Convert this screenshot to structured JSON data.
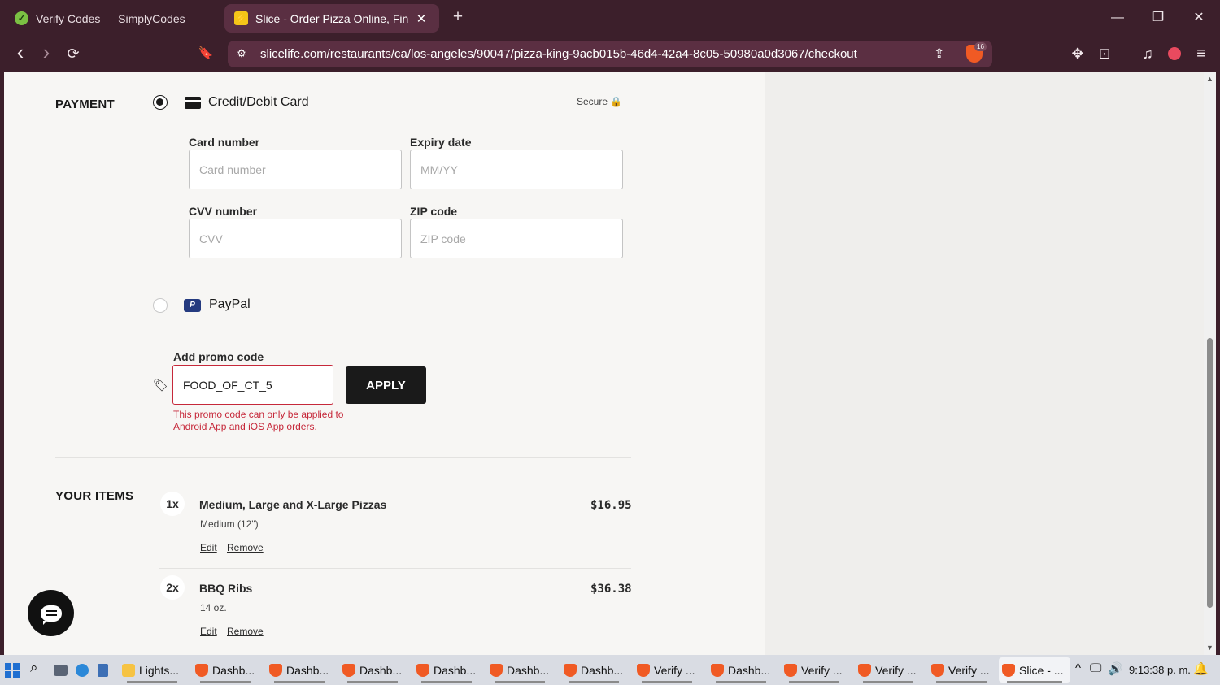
{
  "browser": {
    "tabs": [
      {
        "title": "Verify Codes — SimplyCodes",
        "active": false
      },
      {
        "title": "Slice - Order Pizza Online, Find P",
        "active": true
      }
    ],
    "url": "slicelife.com/restaurants/ca/los-angeles/90047/pizza-king-9acb015b-46d4-42a4-8c05-50980a0d3067/checkout",
    "shield_count": "16",
    "icons": {
      "back": "‹",
      "forward": "›",
      "reload": "⟳",
      "bookmark": "🔖",
      "new_tab": "+",
      "close": "✕",
      "minimize": "—",
      "restore": "❐",
      "share": "⇪",
      "tune": "⚙",
      "extensions": "✥",
      "tab_search": "⊡",
      "music": "♫",
      "menu": "≡"
    }
  },
  "payment": {
    "section_title": "PAYMENT",
    "card_option_label": "Credit/Debit Card",
    "secure_label": "Secure 🔒",
    "card_number_label": "Card number",
    "card_number_placeholder": "Card number",
    "expiry_label": "Expiry date",
    "expiry_placeholder": "MM/YY",
    "cvv_label": "CVV number",
    "cvv_placeholder": "CVV",
    "zip_label": "ZIP code",
    "zip_placeholder": "ZIP code",
    "paypal_label": "PayPal",
    "paypal_icon": "P",
    "selected_method": "card"
  },
  "promo": {
    "label": "Add promo code",
    "value": "FOOD_OF_CT_5",
    "apply_label": "APPLY",
    "error": "This promo code can only be applied to Android App and iOS App orders.",
    "tag_icon": "🏷"
  },
  "items": {
    "section_title": "YOUR ITEMS",
    "list": [
      {
        "qty": "1x",
        "name": "Medium, Large and X-Large Pizzas",
        "detail": "Medium (12\")",
        "price": "$16.95",
        "edit": "Edit",
        "remove": "Remove"
      },
      {
        "qty": "2x",
        "name": "BBQ Ribs",
        "detail": "14 oz.",
        "price": "$36.38",
        "edit": "Edit",
        "remove": "Remove"
      }
    ]
  },
  "taskbar": {
    "items": [
      {
        "label": "Lights...",
        "icon": "folder"
      },
      {
        "label": "Dashb...",
        "icon": "brave"
      },
      {
        "label": "Dashb...",
        "icon": "brave"
      },
      {
        "label": "Dashb...",
        "icon": "brave"
      },
      {
        "label": "Dashb...",
        "icon": "brave"
      },
      {
        "label": "Dashb...",
        "icon": "brave"
      },
      {
        "label": "Dashb...",
        "icon": "brave"
      },
      {
        "label": "Verify ...",
        "icon": "brave"
      },
      {
        "label": "Dashb...",
        "icon": "brave"
      },
      {
        "label": "Verify ...",
        "icon": "brave"
      },
      {
        "label": "Verify ...",
        "icon": "brave"
      },
      {
        "label": "Verify ...",
        "icon": "brave"
      },
      {
        "label": "Slice - ...",
        "icon": "brave",
        "active": true
      }
    ],
    "clock": "9:13:38 p. m.",
    "tray_icons": {
      "chevron": "^",
      "network": "🖵",
      "volume": "🔊",
      "notifications": "🔔"
    }
  }
}
